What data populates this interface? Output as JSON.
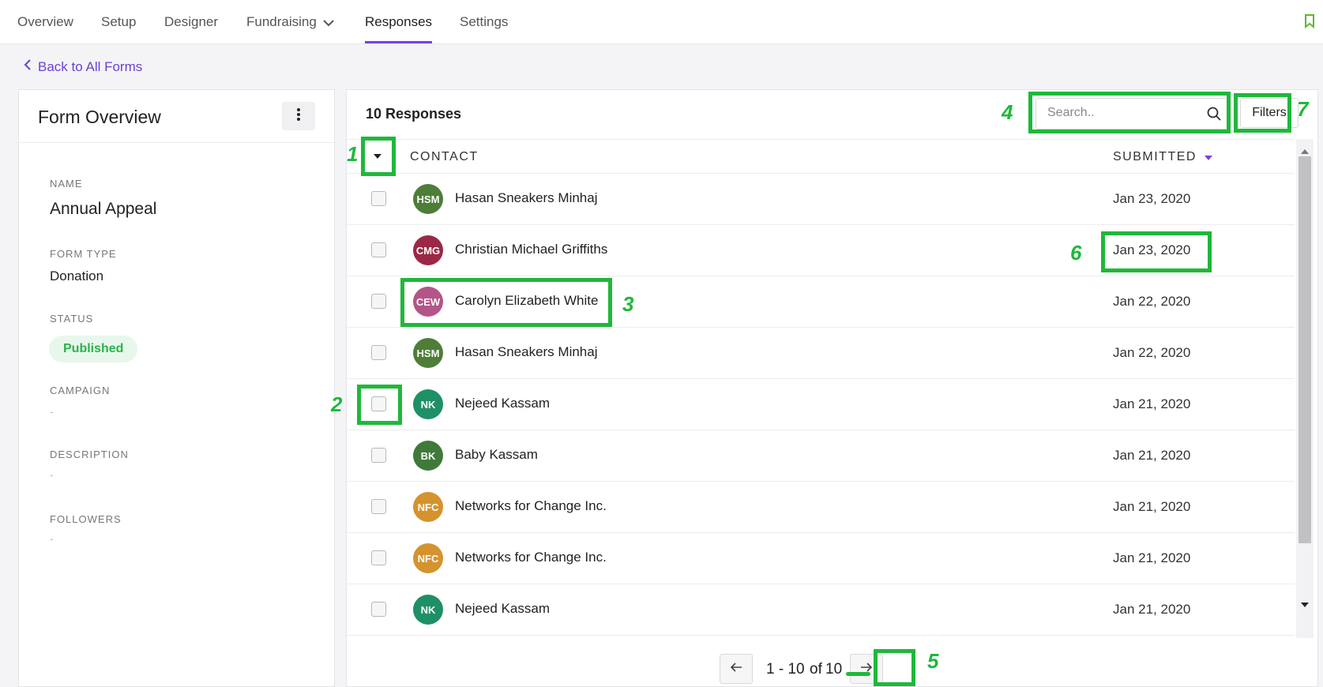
{
  "nav": {
    "tabs": [
      "Overview",
      "Setup",
      "Designer",
      "Fundraising",
      "Responses",
      "Settings"
    ],
    "active_tab": "Responses"
  },
  "back_link": "Back to All Forms",
  "form_overview": {
    "title": "Form Overview",
    "name_label": "NAME",
    "name_value": "Annual Appeal",
    "form_type_label": "FORM TYPE",
    "form_type_value": "Donation",
    "status_label": "STATUS",
    "status_value": "Published",
    "campaign_label": "CAMPAIGN",
    "campaign_value": "-",
    "description_label": "DESCRIPTION",
    "description_value": "-",
    "followers_label": "FOLLOWERS",
    "followers_value": "-"
  },
  "responses": {
    "title": "10 Responses",
    "search_placeholder": "Search..",
    "filters_label": "Filters",
    "col_contact": "CONTACT",
    "col_submitted": "SUBMITTED",
    "rows": [
      {
        "initials": "HSM",
        "name": "Hasan Sneakers Minhaj",
        "date": "Jan 23, 2020",
        "color": "#4e7d38"
      },
      {
        "initials": "CMG",
        "name": "Christian Michael Griffiths",
        "date": "Jan 23, 2020",
        "color": "#9b2846"
      },
      {
        "initials": "CEW",
        "name": "Carolyn Elizabeth White",
        "date": "Jan 22, 2020",
        "color": "#b35587"
      },
      {
        "initials": "HSM",
        "name": "Hasan Sneakers Minhaj",
        "date": "Jan 22, 2020",
        "color": "#4e7d38"
      },
      {
        "initials": "NK",
        "name": "Nejeed Kassam",
        "date": "Jan 21, 2020",
        "color": "#1f8f66"
      },
      {
        "initials": "BK",
        "name": "Baby Kassam",
        "date": "Jan 21, 2020",
        "color": "#3f7a3a"
      },
      {
        "initials": "NFC",
        "name": "Networks for Change Inc.",
        "date": "Jan 21, 2020",
        "color": "#d4932e"
      },
      {
        "initials": "NFC",
        "name": "Networks for Change Inc.",
        "date": "Jan 21, 2020",
        "color": "#d4932e"
      },
      {
        "initials": "NK",
        "name": "Nejeed Kassam",
        "date": "Jan 21, 2020",
        "color": "#1f8f66"
      }
    ],
    "pagination": {
      "range": "1 - 10",
      "of": "of",
      "total": "10"
    }
  },
  "annotations": [
    "1",
    "2",
    "3",
    "4",
    "5",
    "6",
    "7"
  ],
  "colors": {
    "accent": "#7b3fe4",
    "annotation": "#1fb83a",
    "published": "#2bb24c"
  }
}
